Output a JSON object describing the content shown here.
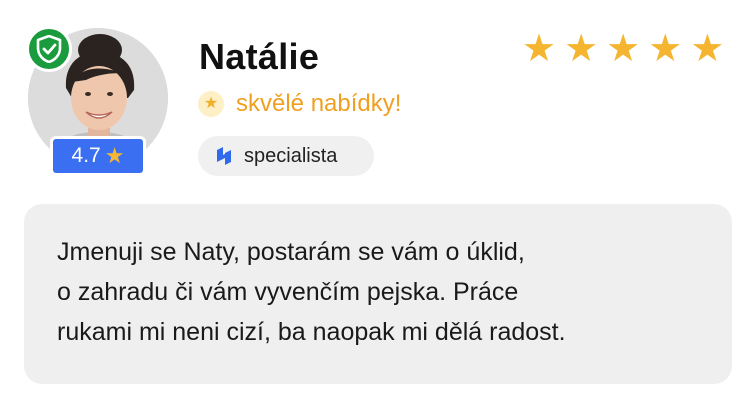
{
  "profile": {
    "name": "Natálie",
    "rating": "4.7",
    "rating_icon": "star-icon",
    "verified_icon": "shield-check-icon",
    "star_count": 5,
    "tagline": "skvělé nabídky!",
    "specialist_label": "specialista",
    "bio_lines": [
      "Jmenuji se Naty, postarám se vám o úklid,",
      "o zahradu či vám vyvenčím pejska. Práce",
      "rukami mi neni cizí, ba naopak mi dělá radost."
    ]
  },
  "colors": {
    "star": "#f5b531",
    "tagline": "#f0a020",
    "rating_badge": "#3a6ff2",
    "verified": "#1a9c3e",
    "pill_bg": "#f0f0f0",
    "bio_bg": "#efefef"
  }
}
